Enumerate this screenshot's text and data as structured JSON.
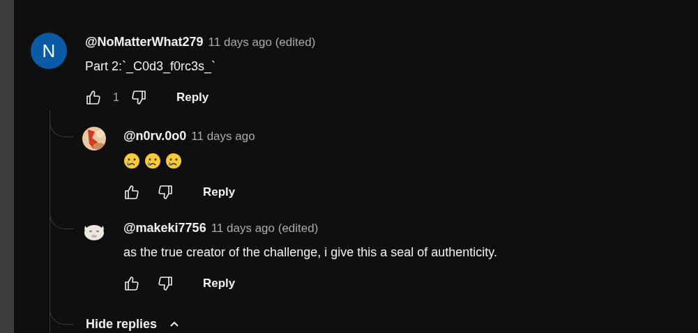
{
  "comment": {
    "avatar_letter": "N",
    "author": "@NoMatterWhat279",
    "time": "11 days ago (edited)",
    "body": "Part 2:`_C0d3_f0rc3s_`",
    "likes": "1",
    "reply_label": "Reply"
  },
  "replies": [
    {
      "author": "@n0rv.0o0",
      "time": "11 days ago",
      "emojis": [
        {
          "kind": "crying-face"
        },
        {
          "kind": "crying-face"
        },
        {
          "kind": "crying-face"
        }
      ],
      "reply_label": "Reply"
    },
    {
      "author": "@makeki7756",
      "time": "11 days ago (edited)",
      "body": "as the true creator of the challenge, i give this a seal of authenticity.",
      "reply_label": "Reply"
    }
  ],
  "hide_replies": {
    "label": "Hide replies"
  }
}
